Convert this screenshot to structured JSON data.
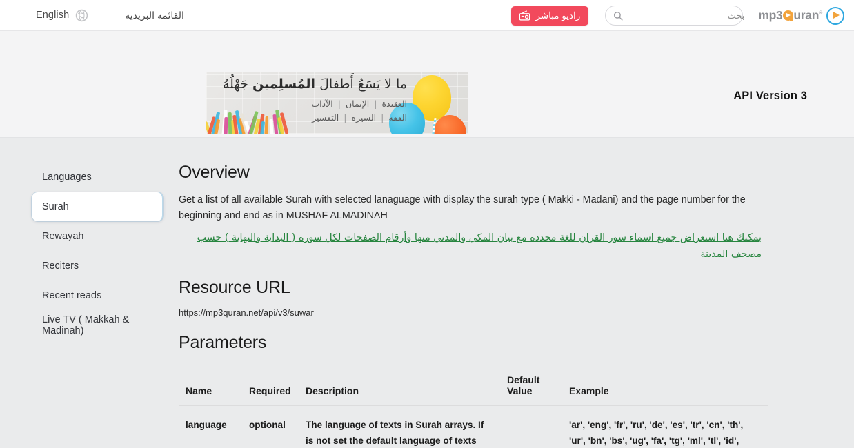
{
  "topbar": {
    "language_label": "English",
    "globe_icon": "globe-icon",
    "mailing_list_label": "القائمة البريدية",
    "radio_button_label": "راديو مباشر",
    "radio_icon": "radio-icon",
    "radio_button_color": "#f2495c",
    "search_placeholder": "بحث",
    "search_value": "",
    "search_icon": "search-icon",
    "logo": {
      "text_before": "mp3",
      "text_after": "uran",
      "registered": "®",
      "q_color": "#f2a33c",
      "play_color": "#2fa8e0",
      "word_color": "#8d8f93"
    }
  },
  "banner": {
    "title_plain_1": "ما لا يَسَعُ أَطفالَ ",
    "title_bold": "المُسلِمين",
    "title_plain_2": " جَهْلُهُ",
    "row1": [
      "العقيدة",
      "الإيمان",
      "الآداب"
    ],
    "row2": [
      "الفقه",
      "السيرة",
      "التفسير"
    ],
    "separator": "|",
    "api_version": "API Version 3"
  },
  "sidebar": {
    "items": [
      {
        "label": "Languages",
        "active": false
      },
      {
        "label": "Surah",
        "active": true
      },
      {
        "label": "Rewayah",
        "active": false
      },
      {
        "label": "Reciters",
        "active": false
      },
      {
        "label": "Recent reads",
        "active": false
      },
      {
        "label": "Live TV ( Makkah & Madinah)",
        "active": false
      }
    ]
  },
  "content": {
    "overview_heading": "Overview",
    "overview_paragraph": "Get a list of all available Surah with selected lanaguage with display the surah type ( Makki - Madani) and the page number for the beginning and end as in MUSHAF ALMADINAH",
    "overview_arabic_link": "بمكنك هنا استعراض جميع اسماء سور القران للغة محددة مع بيان المكي والمدني منها وأرقام الصفحات لكل سورة ( البداية والنهاية ) حسب مصحف المدينة",
    "arabic_link_color": "#27853f",
    "resource_url_heading": "Resource URL",
    "resource_url": "https://mp3quran.net/api/v3/suwar",
    "parameters_heading": "Parameters",
    "table": {
      "headers": {
        "name": "Name",
        "required": "Required",
        "description": "Description",
        "default_value_line1": "Default",
        "default_value_line2": "Value",
        "example": "Example"
      },
      "rows": [
        {
          "name": "language",
          "required": "optional",
          "description": "The language of texts in Surah arrays. If is not set the default language of texts",
          "default_value": "",
          "example": "'ar', 'eng', 'fr', 'ru', 'de', 'es', 'tr', 'cn', 'th', 'ur', 'bn', 'bs', 'ug', 'fa', 'tg', 'ml', 'tl', 'id',"
        }
      ]
    }
  }
}
